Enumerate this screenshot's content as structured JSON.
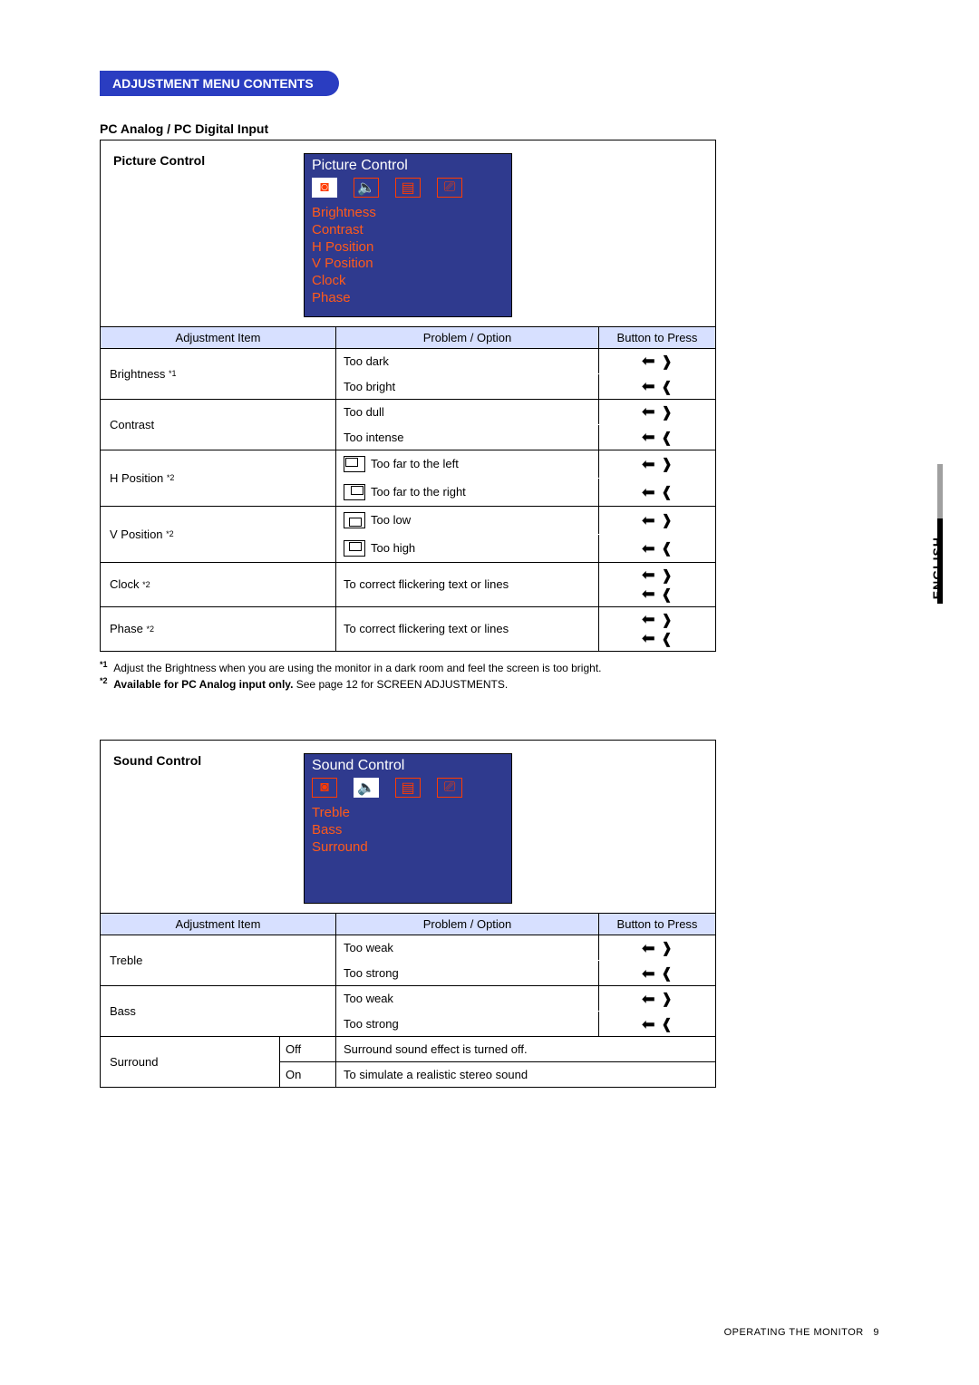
{
  "header": {
    "pill": "ADJUSTMENT MENU CONTENTS",
    "subhead": "PC Analog / PC Digital Input"
  },
  "picture": {
    "label": "Picture Control",
    "osd_title": "Picture Control",
    "osd_items": [
      "Brightness",
      "Contrast",
      "H Position",
      "V Position",
      "Clock",
      "Phase"
    ],
    "cols": {
      "adj": "Adjustment Item",
      "prob": "Problem / Option",
      "btn": "Button to Press"
    },
    "rows": [
      {
        "item": "Brightness",
        "sup": "*1",
        "opts": [
          "Too dark",
          "Too bright"
        ]
      },
      {
        "item": "Contrast",
        "sup": "",
        "opts": [
          "Too dull",
          "Too intense"
        ]
      },
      {
        "item": "H Position",
        "sup": "*2",
        "opts": [
          "Too far to the left",
          "Too far to the right"
        ],
        "diag": "h"
      },
      {
        "item": "V Position",
        "sup": "*2",
        "opts": [
          "Too low",
          "Too high"
        ],
        "diag": "v"
      },
      {
        "item": "Clock",
        "sup": "*2",
        "opts": [
          "To correct flickering text or lines"
        ],
        "single": true
      },
      {
        "item": "Phase",
        "sup": "*2",
        "opts": [
          "To correct flickering text or lines"
        ],
        "single": true
      }
    ]
  },
  "notes": {
    "n1_sup": "*1",
    "n1": "Adjust the Brightness when you are using the monitor in a dark room and feel the screen is too bright.",
    "n2_sup": "*2",
    "n2_bold": "Available for PC Analog input only.",
    "n2_rest": " See page 12 for SCREEN ADJUSTMENTS."
  },
  "sound": {
    "label": "Sound Control",
    "osd_title": "Sound Control",
    "osd_items": [
      "Treble",
      "Bass",
      "Surround"
    ],
    "cols": {
      "adj": "Adjustment Item",
      "prob": "Problem / Option",
      "btn": "Button to Press"
    },
    "rows": [
      {
        "item": "Treble",
        "opts": [
          "Too weak",
          "Too strong"
        ]
      },
      {
        "item": "Bass",
        "opts": [
          "Too weak",
          "Too strong"
        ]
      }
    ],
    "surround": {
      "item": "Surround",
      "off_label": "Off",
      "off_desc": "Surround sound effect is turned off.",
      "on_label": "On",
      "on_desc": "To simulate a realistic stereo sound"
    }
  },
  "lang": "ENGLISH",
  "footer": {
    "label": "OPERATING THE MONITOR",
    "page": "9"
  }
}
